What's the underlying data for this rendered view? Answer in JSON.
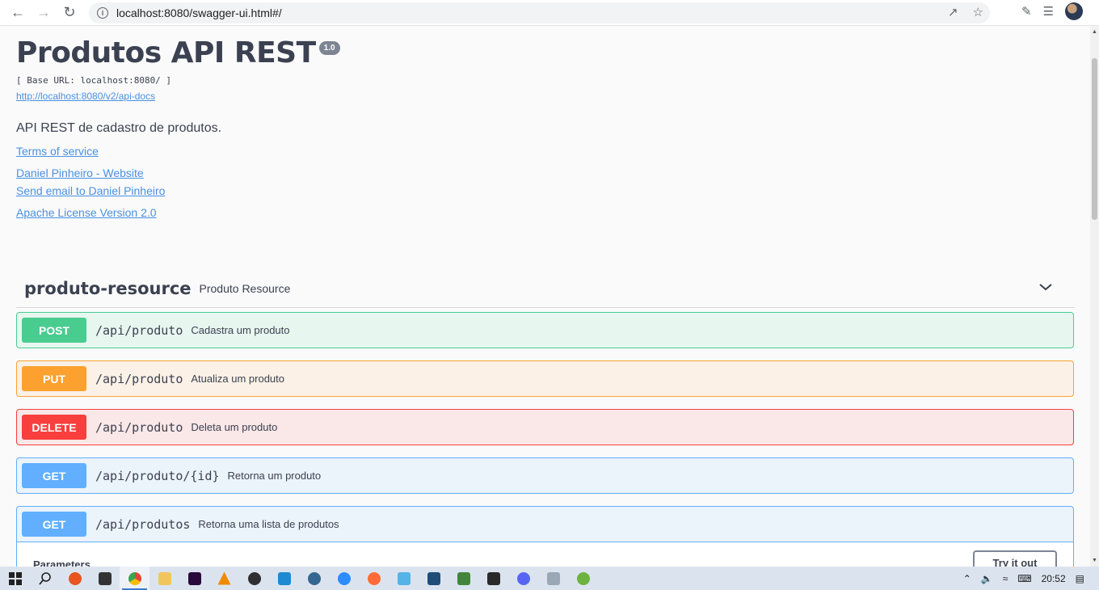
{
  "browser": {
    "url": "localhost:8080/swagger-ui.html#/"
  },
  "info": {
    "title": "Produtos API REST",
    "version": "1.0",
    "base_url": "[ Base URL: localhost:8080/ ]",
    "docs_link": "http://localhost:8080/v2/api-docs",
    "description": "API REST de cadastro de produtos.",
    "terms": "Terms of service",
    "website": "Daniel Pinheiro - Website",
    "email": "Send email to Daniel Pinheiro",
    "license": "Apache License Version 2.0"
  },
  "tag": {
    "name": "produto-resource",
    "description": "Produto Resource"
  },
  "operations": [
    {
      "method": "POST",
      "path": "/api/produto",
      "summary": "Cadastra um produto"
    },
    {
      "method": "PUT",
      "path": "/api/produto",
      "summary": "Atualiza um produto"
    },
    {
      "method": "DELETE",
      "path": "/api/produto",
      "summary": "Deleta um produto"
    },
    {
      "method": "GET",
      "path": "/api/produto/{id}",
      "summary": "Retorna um produto"
    },
    {
      "method": "GET",
      "path": "/api/produtos",
      "summary": "Retorna uma lista de produtos"
    }
  ],
  "expanded": {
    "parameters_label": "Parameters",
    "try_label": "Try it out"
  },
  "taskbar": {
    "time": "20:52",
    "apps": [
      "ubuntu-icon",
      "terminal-icon",
      "chrome-icon",
      "file-explorer-icon",
      "premiere-icon",
      "vlc-icon",
      "obs-icon",
      "vscode-icon",
      "postgres-icon",
      "zoom-icon",
      "postman-icon",
      "sourcetree-icon",
      "sql-developer-icon",
      "nodejs-icon",
      "epic-games-icon",
      "discord-icon",
      "image-viewer-icon",
      "spring-icon"
    ]
  },
  "colors": {
    "post": "#49cc90",
    "put": "#fca130",
    "delete": "#f93e3e",
    "get": "#61affe",
    "link": "#4990e2",
    "text": "#3b4151"
  }
}
